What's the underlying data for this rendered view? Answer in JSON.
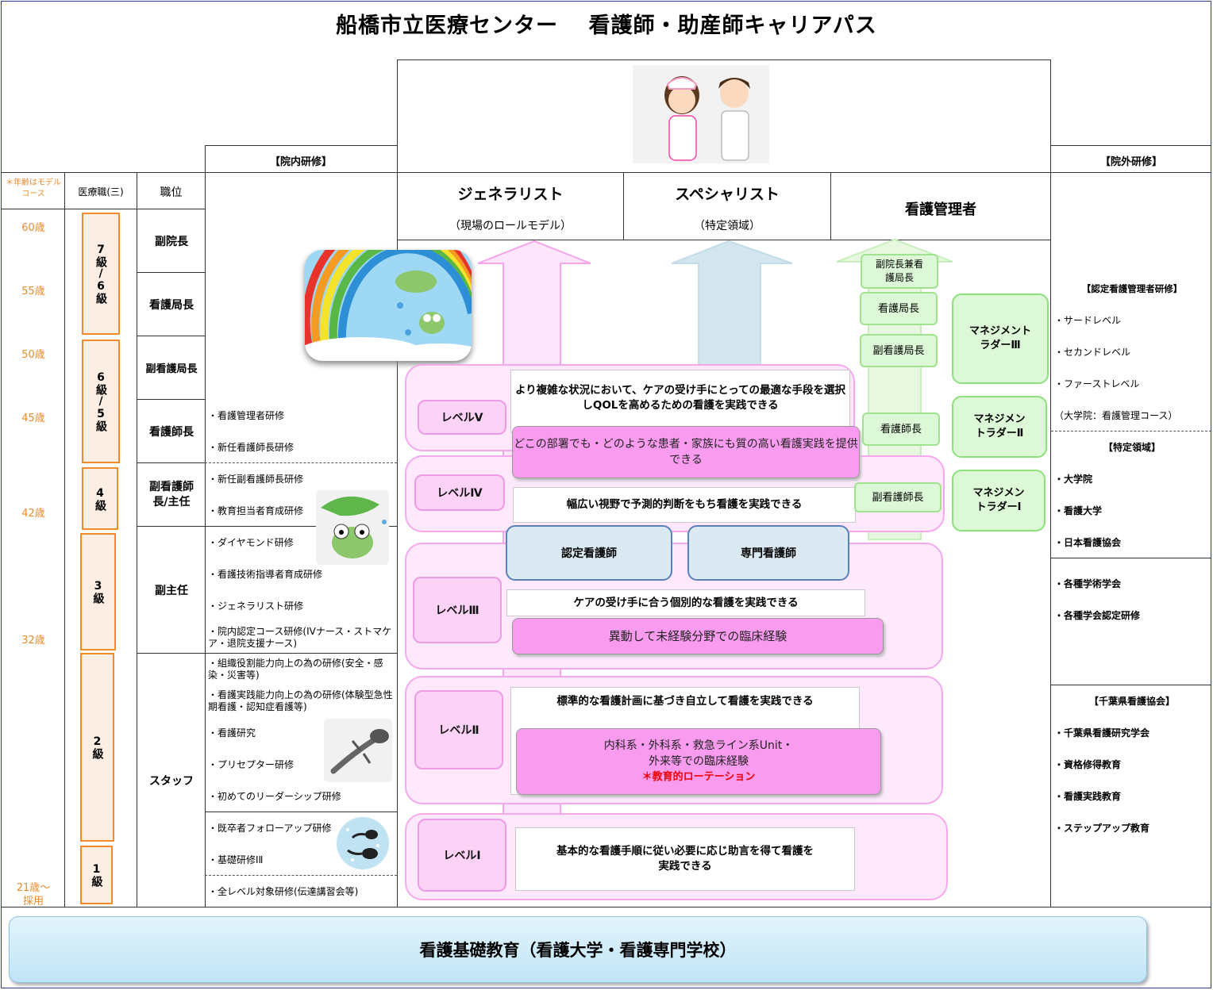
{
  "title": "船橋市立医療センター　 看護師・助産師キャリアパス",
  "headers": {
    "innai": "【院内研修】",
    "ingai": "【院外研修】",
    "age_note": "＊年齢はモデルコース",
    "grade_col": "医療職(三)",
    "pos_col": "職位"
  },
  "columns": [
    {
      "name": "ジェネラリスト",
      "sub": "（現場のロールモデル）"
    },
    {
      "name": "スペシャリスト",
      "sub": "（特定領域）"
    },
    {
      "name": "看護管理者",
      "sub": ""
    }
  ],
  "ages": [
    "60歳",
    "55歳",
    "50歳",
    "45歳",
    "42歳",
    "32歳",
    "21歳～",
    "採用"
  ],
  "grades": [
    "7級/6級",
    "6級/5級",
    "4級",
    "3級",
    "2級",
    "1級"
  ],
  "positions": [
    "副院長",
    "看護局長",
    "副看護局長",
    "看護師長",
    "副看護師長/主任",
    "副主任",
    "スタッフ"
  ],
  "trainings": [
    "・看護管理者研修",
    "・新任看護師長研修",
    "・新任副看護師長研修",
    "・教育担当者育成研修",
    "・ダイヤモンド研修",
    "・看護技術指導者育成研修",
    "・ジェネラリスト研修",
    "・院内認定コース研修(IVナース・ストマケア・退院支援ナース)",
    "・組織役割能力向上の為の研修(安全・感染・災害等)",
    "・看護実践能力向上の為の研修(体験型急性期看護・認知症看護等)",
    "・看護研究",
    "・プリセプター研修",
    "・初めてのリーダーシップ研修",
    "・既卒者フォローアップ研修",
    "・基礎研修ⅠⅡ",
    "・全レベル対象研修(伝達講習会等)"
  ],
  "external": [
    "【認定看護管理者研修】",
    "・サードレベル",
    "・セカンドレベル",
    "・ファーストレベル",
    "（大学院：看護管理コース）",
    "【特定領域】",
    "・大学院",
    "・看護大学",
    "・日本看護協会",
    "・各種学術学会",
    "・各種学会認定研修",
    "【千葉県看護協会】",
    "・千葉県看護研究学会",
    "・資格修得教育",
    "・看護実践教育",
    "・ステップアップ教育"
  ],
  "levels": [
    {
      "label": "レベルⅤ",
      "desc": "より複雑な状況において、ケアの受け手にとっての最適な手段を選択しQOLを高めるための看護を実践できる",
      "note": "どこの部署でも・どのような患者・家族にも質の高い看護実践を提供できる"
    },
    {
      "label": "レベルⅣ",
      "desc": "幅広い視野で予測的判断をもち看護を実践できる"
    },
    {
      "label": "レベルⅢ",
      "desc": "ケアの受け手に合う個別的な看護を実践できる",
      "note": "異動して未経験分野での臨床経験"
    },
    {
      "label": "レベルⅡ",
      "desc": "標準的な看護計画に基づき自立して看護を実践できる",
      "note1": "内科系・外科系・救急ライン系Unit・",
      "note2": "外来等での臨床経験",
      "note3": "＊教育的ローテーション"
    },
    {
      "label": "レベルⅠ",
      "desc": "基本的な看護手順に従い必要に応じ助言を得て看護を実践できる"
    }
  ],
  "specialist": [
    "認定看護師",
    "専門看護師"
  ],
  "mgmt_positions": [
    "副院長兼看護局長",
    "看護局長",
    "副看護局長",
    "看護師長",
    "副看護師長"
  ],
  "ladders": [
    "マネジメントラダーⅢ",
    "マネジメントラダーⅡ",
    "マネジメントラダーⅠ"
  ],
  "footer": "看護基礎教育（看護大学・看護専門学校）",
  "colors": {
    "age": "#e98b2c",
    "grade_border": "#f28c28",
    "level_pink": "#f99cf0",
    "green": "#8ee07d",
    "blue_arrow": "#d3e6f0"
  }
}
